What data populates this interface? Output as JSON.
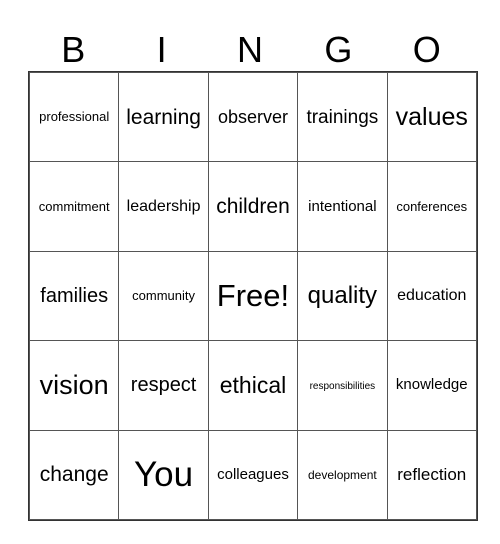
{
  "title_letters": [
    "B",
    "I",
    "N",
    "G",
    "O"
  ],
  "rows": [
    [
      {
        "text": "professional",
        "size": 13
      },
      {
        "text": "learning",
        "size": 21
      },
      {
        "text": "observer",
        "size": 18
      },
      {
        "text": "trainings",
        "size": 19
      },
      {
        "text": "values",
        "size": 25
      }
    ],
    [
      {
        "text": "commitment",
        "size": 13
      },
      {
        "text": "leadership",
        "size": 16
      },
      {
        "text": "children",
        "size": 21
      },
      {
        "text": "intentional",
        "size": 15
      },
      {
        "text": "conferences",
        "size": 13
      }
    ],
    [
      {
        "text": "families",
        "size": 20
      },
      {
        "text": "community",
        "size": 13
      },
      {
        "text": "Free!",
        "size": 31
      },
      {
        "text": "quality",
        "size": 24
      },
      {
        "text": "education",
        "size": 16
      }
    ],
    [
      {
        "text": "vision",
        "size": 27
      },
      {
        "text": "respect",
        "size": 20
      },
      {
        "text": "ethical",
        "size": 23
      },
      {
        "text": "responsibilities",
        "size": 10
      },
      {
        "text": "knowledge",
        "size": 15
      }
    ],
    [
      {
        "text": "change",
        "size": 21
      },
      {
        "text": "You",
        "size": 35
      },
      {
        "text": "colleagues",
        "size": 15
      },
      {
        "text": "development",
        "size": 12
      },
      {
        "text": "reflection",
        "size": 17
      }
    ]
  ]
}
